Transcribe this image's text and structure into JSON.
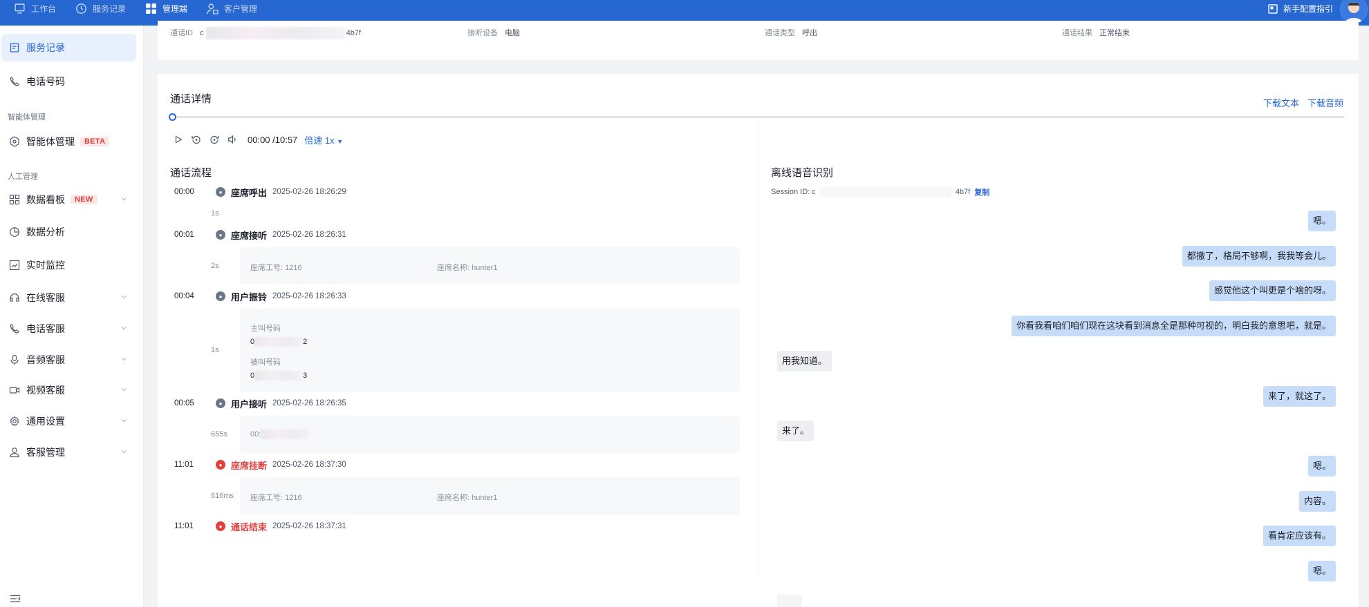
{
  "topbar": {
    "nav": [
      {
        "label": "工作台",
        "icon": "monitor-icon"
      },
      {
        "label": "服务记录",
        "icon": "clock-icon"
      },
      {
        "label": "管理端",
        "icon": "grid-icon"
      },
      {
        "label": "客户管理",
        "icon": "users-icon"
      }
    ],
    "guide_label": "新手配置指引"
  },
  "sidebar": {
    "items": [
      {
        "label": "服务记录",
        "icon": "file-icon"
      },
      {
        "label": "电话号码",
        "icon": "phone-icon"
      }
    ],
    "group_agent": "智能体管理",
    "agent_item": {
      "label": "智能体管理",
      "tag": "BETA"
    },
    "group_manual": "人工管理",
    "manual_items": [
      {
        "label": "数据看板",
        "tag": "NEW"
      },
      {
        "label": "数据分析"
      },
      {
        "label": "实时监控"
      },
      {
        "label": "在线客服"
      },
      {
        "label": "电话客服"
      },
      {
        "label": "音频客服"
      },
      {
        "label": "视频客服"
      },
      {
        "label": "通用设置"
      },
      {
        "label": "客服管理"
      }
    ]
  },
  "call_info": {
    "id_label": "通话ID",
    "id_prefix": "c",
    "id_suffix": "4b7f",
    "device_label": "接听设备",
    "device_value": "电脑",
    "type_label": "通话类型",
    "type_value": "呼出",
    "result_label": "通话结果",
    "result_value": "正常结束"
  },
  "details": {
    "title": "通话详情",
    "download_text": "下载文本",
    "download_audio": "下载音频",
    "progress": 0.0,
    "time": "00:00 /10:57",
    "speed": "倍速 1x"
  },
  "flow": {
    "title": "通话流程",
    "events": [
      {
        "t": "00:00",
        "name": "座席呼出",
        "date": "2025-02-26 18:26:29",
        "type": "normal"
      },
      {
        "t": "00:01",
        "name": "座席接听",
        "date": "2025-02-26 18:26:31",
        "type": "normal"
      },
      {
        "t": "00:04",
        "name": "用户振铃",
        "date": "2025-02-26 18:26:33",
        "type": "normal"
      },
      {
        "t": "00:05",
        "name": "用户接听",
        "date": "2025-02-26 18:26:35",
        "type": "normal"
      },
      {
        "t": "11:01",
        "name": "座席挂断",
        "date": "2025-02-26 18:37:30",
        "type": "end"
      },
      {
        "t": "11:01",
        "name": "通话结束",
        "date": "2025-02-26 18:37:31",
        "type": "end"
      }
    ],
    "durations": [
      "1s",
      "2s",
      "1s",
      "655s",
      "616ms"
    ],
    "agent_id_label": "座席工号:",
    "agent_id": "1216",
    "agent_name_label": "座席名称:",
    "agent_name": "hunter1",
    "caller_label": "主叫号码",
    "caller_prefix": "0",
    "caller_suffix": "2",
    "callee_label": "被叫号码",
    "callee_prefix": "0",
    "callee_suffix": "3",
    "listen_prefix": "00:"
  },
  "transcript": {
    "title": "离线语音识别",
    "session_label": "Session ID: c",
    "session_suffix": "4b7f",
    "copy_label": "复制",
    "lines": [
      {
        "text": "嗯。",
        "side": "right"
      },
      {
        "text": "都撤了，格局不够啊，我我等会儿。",
        "side": "right"
      },
      {
        "text": "感觉他这个叫更是个啥的呀。",
        "side": "right"
      },
      {
        "text": "你看我看咱们咱们现在这块看到消息全是那种可视的，明白我的意思吧，就是。",
        "side": "right"
      },
      {
        "text": "用我知道。",
        "side": "left"
      },
      {
        "text": "来了，就这了。",
        "side": "right"
      },
      {
        "text": "来了。",
        "side": "left"
      },
      {
        "text": "嗯。",
        "side": "right"
      },
      {
        "text": "内容。",
        "side": "right"
      },
      {
        "text": "看肯定应该有。",
        "side": "right"
      },
      {
        "text": "嗯。",
        "side": "right"
      }
    ]
  }
}
